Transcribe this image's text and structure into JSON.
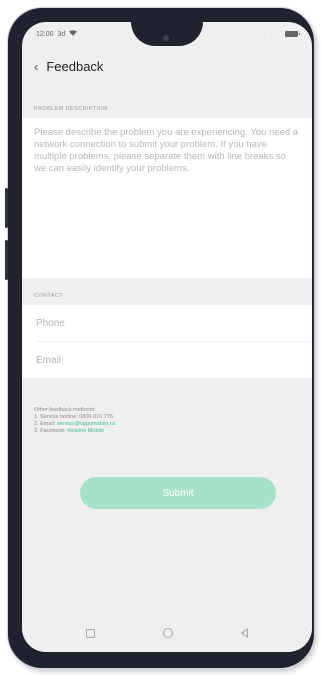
{
  "status_bar": {
    "time": "12:00",
    "signal": "3d",
    "dots": "· · ·"
  },
  "header": {
    "back_icon": "‹",
    "title": "Feedback"
  },
  "problem": {
    "section_label": "PROBLEM DESCRIPTION",
    "placeholder": "Please describe the problem you are experiencing. You need a network connection to submit your problem. If you have multiple problems, please separate them with line breaks so we can easily identify your problems."
  },
  "contact": {
    "section_label": "CONTACT",
    "phone_placeholder": "Phone",
    "email_placeholder": "Email"
  },
  "other_methods": {
    "heading": "Other feedback methods:",
    "line1": "1. Service hotline: 0800 016 776",
    "line2_prefix": "2. Email: ",
    "line2_link": "service@oppomobile.nz",
    "line3_prefix": "3. Facebook: ",
    "line3_link": "Realme Mobile"
  },
  "submit": {
    "label": "Submit"
  },
  "colors": {
    "accent": "#3fbf86",
    "submit_bg": "#a6e2c8",
    "screen_bg": "#efefef"
  },
  "icons": {
    "back": "chevron-left-icon",
    "nav_recent": "square-icon",
    "nav_home": "circle-icon",
    "nav_back": "triangle-back-icon"
  }
}
